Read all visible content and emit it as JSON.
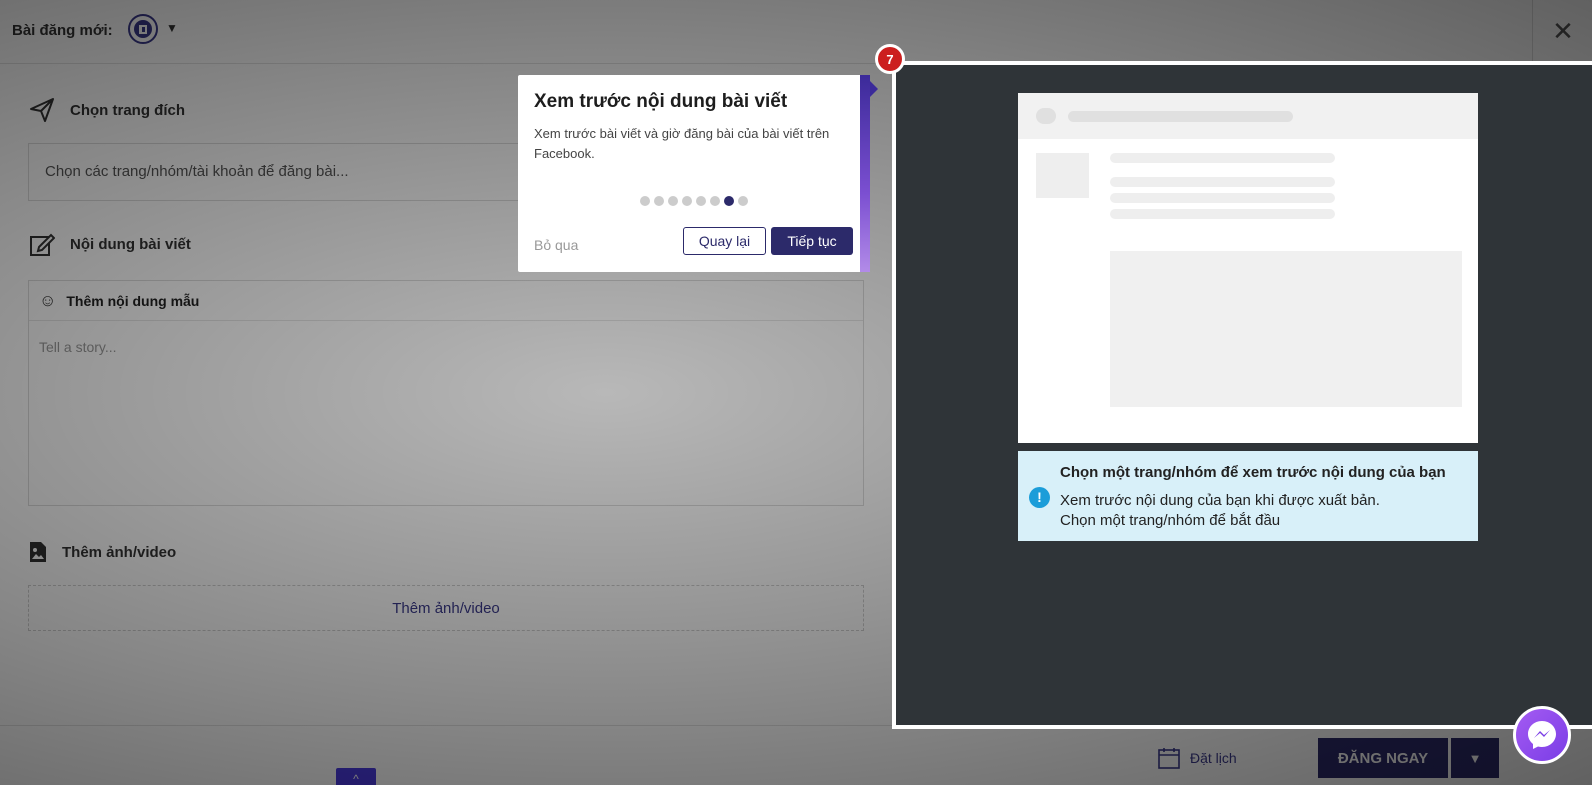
{
  "topbar": {
    "title": "Bài đăng mới:",
    "avatar_icon": "page-avatar-icon",
    "close_icon": "close-icon"
  },
  "sections": {
    "target": {
      "heading": "Chọn trang đích",
      "placeholder": "Chọn các trang/nhóm/tài khoản để đăng bài..."
    },
    "content": {
      "heading": "Nội dung bài viết",
      "template_label": "Thêm nội dung mẫu",
      "story_placeholder": "Tell a story..."
    },
    "media": {
      "heading": "Thêm ảnh/video",
      "drop_label": "Thêm ảnh/video"
    }
  },
  "preview": {
    "info_title": "Chọn một trang/nhóm để xem trước nội dung của bạn",
    "info_line1": "Xem trước nội dung của bạn khi được xuất bản.",
    "info_line2": "Chọn một trang/nhóm để bắt đầu"
  },
  "tour": {
    "step": "7",
    "title": "Xem trước nội dung bài viết",
    "description": "Xem trước bài viết và giờ đăng bài của bài viết trên Facebook.",
    "total_steps": 8,
    "active_step_index": 6,
    "skip_label": "Bỏ qua",
    "back_label": "Quay lại",
    "next_label": "Tiếp tục"
  },
  "footer": {
    "schedule_label": "Đặt lịch",
    "post_now_label": "ĐĂNG NGAY"
  },
  "colors": {
    "brand": "#2c2a6a",
    "tour_accent": "#7b4fd1",
    "badge": "#cc1e1e",
    "info_bg": "#d8f0f9",
    "preview_bg": "#2f3438"
  }
}
